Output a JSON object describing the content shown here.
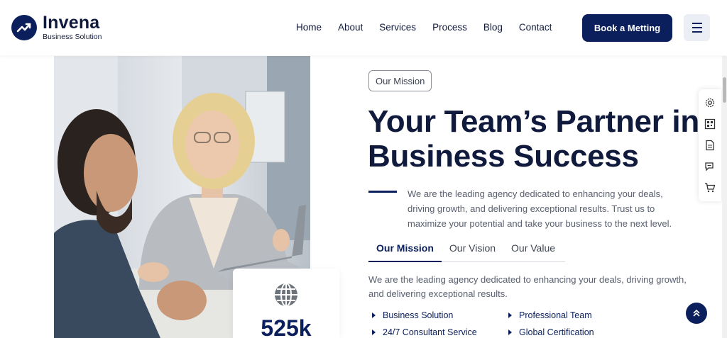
{
  "brand": {
    "name": "Invena",
    "tagline": "Business Solution",
    "icon": "trend-arrow-logo-icon"
  },
  "nav": {
    "items": [
      "Home",
      "About",
      "Services",
      "Process",
      "Blog",
      "Contact"
    ]
  },
  "header": {
    "cta_label": "Book a Metting",
    "menu_icon": "hamburger-icon"
  },
  "hero_image": {
    "description_icon": "meeting-photo"
  },
  "stat": {
    "icon": "globe-icon",
    "value": "525k"
  },
  "mission": {
    "badge": "Our Mission",
    "title_line1": "Your Team’s Partner in",
    "title_line2": "Business Success",
    "lead": "We are the leading agency dedicated to enhancing your deals, driving growth, and delivering exceptional results. Trust us to maximize your potential and take your business to the next level.",
    "tabs": [
      "Our Mission",
      "Our Vision",
      "Our Value"
    ],
    "active_tab": "Our Mission",
    "tab_text": "We are the leading agency dedicated to enhancing your deals, driving growth, and delivering exceptional results.",
    "features": [
      "Business Solution",
      "Professional Team",
      "24/7 Consultant Service",
      "Global Certification"
    ]
  },
  "side_tools": [
    "settings-icon",
    "qr-code-icon",
    "document-icon",
    "chat-icon",
    "cart-icon"
  ],
  "colors": {
    "primary": "#0b1f5c",
    "text": "#0f1a3c",
    "muted": "#5a6070"
  }
}
